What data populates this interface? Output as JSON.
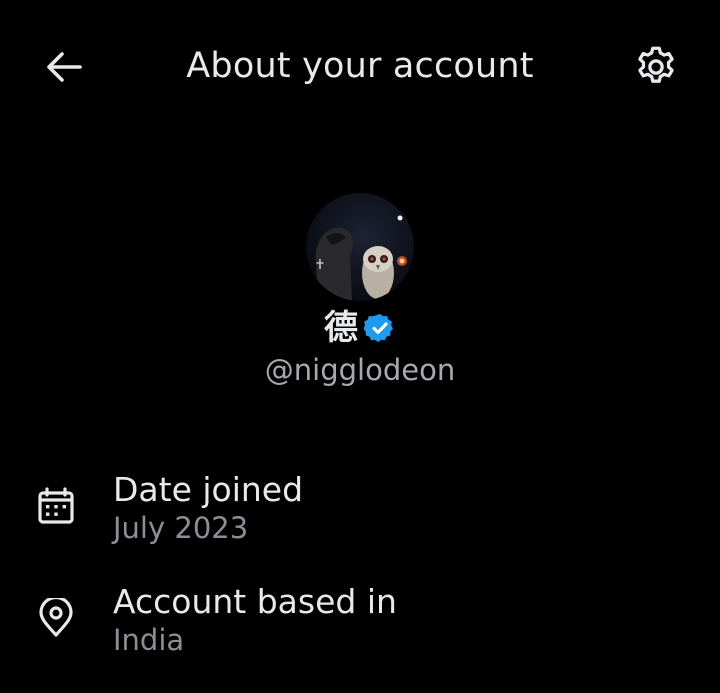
{
  "header": {
    "title": "About your account",
    "back_icon": "arrow-left-icon",
    "settings_icon": "gear-icon"
  },
  "profile": {
    "display_name": "德",
    "verified": true,
    "verified_color": "#1d9bf0",
    "handle": "@nigglodeon"
  },
  "info": [
    {
      "icon": "calendar-icon",
      "label": "Date joined",
      "value": "July 2023"
    },
    {
      "icon": "location-pin-icon",
      "label": "Account based in",
      "value": "India"
    }
  ],
  "colors": {
    "background": "#000000",
    "primary_text": "#e7e9ea",
    "secondary_text": "#8b8f94"
  }
}
